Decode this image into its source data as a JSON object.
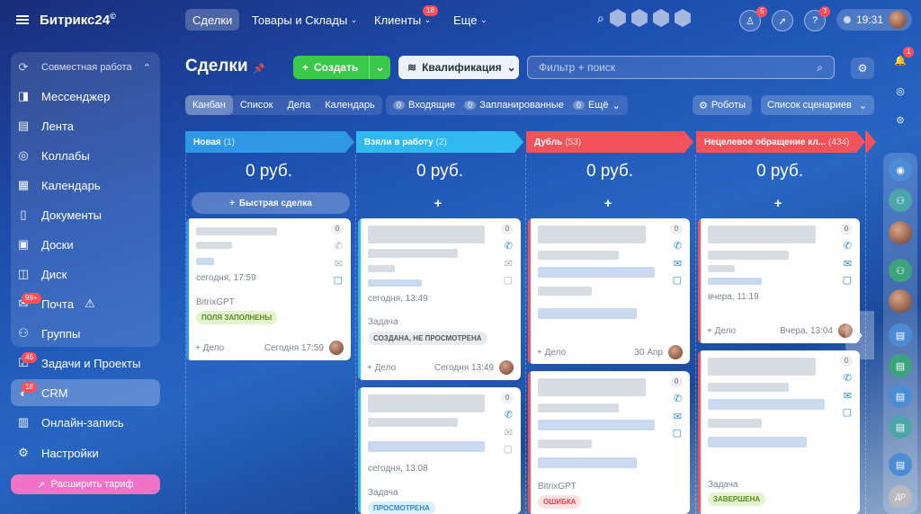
{
  "app": {
    "logo": "Битрикс24",
    "logo_mark": "©"
  },
  "sidebar": {
    "group_label": "Совместная работа",
    "items": [
      {
        "label": "Мессенджер",
        "icon": "chat-icon"
      },
      {
        "label": "Лента",
        "icon": "feed-icon"
      },
      {
        "label": "Коллабы",
        "icon": "collab-icon"
      },
      {
        "label": "Календарь",
        "icon": "calendar-icon"
      },
      {
        "label": "Документы",
        "icon": "document-icon"
      },
      {
        "label": "Доски",
        "icon": "board-icon"
      },
      {
        "label": "Диск",
        "icon": "disk-icon"
      },
      {
        "label": "Почта",
        "icon": "mail-icon",
        "badge": "99+"
      },
      {
        "label": "Группы",
        "icon": "groups-icon"
      },
      {
        "label": "Задачи и Проекты",
        "icon": "tasks-icon",
        "badge": "46"
      },
      {
        "label": "CRM",
        "icon": "crm-icon",
        "badge": "18"
      },
      {
        "label": "Онлайн-запись",
        "icon": "booking-icon"
      },
      {
        "label": "Настройки",
        "icon": "gear-icon"
      }
    ],
    "upgrade_label": "Расширить тариф"
  },
  "topnav": {
    "tabs": [
      {
        "label": "Сделки"
      },
      {
        "label": "Товары и Склады"
      },
      {
        "label": "Клиенты",
        "badge": "18"
      },
      {
        "label": "Еще"
      }
    ],
    "notif_badges": [
      "5",
      "7"
    ],
    "time": "19:31"
  },
  "toolbar": {
    "title": "Сделки",
    "create_label": "Создать",
    "qual_label": "Квалификация",
    "filter_placeholder": "Фильтр + поиск"
  },
  "views": [
    "Канбан",
    "Список",
    "Дела",
    "Календарь"
  ],
  "counters": [
    {
      "n": "0",
      "label": "Входящие"
    },
    {
      "n": "0",
      "label": "Запланированные"
    },
    {
      "n": "0",
      "label": "Ещё"
    }
  ],
  "robots_label": "Роботы",
  "scenarios_label": "Список сценариев",
  "quick_deal_label": "Быстрая сделка",
  "columns": [
    {
      "name": "Новая",
      "count": "(1)",
      "sum": "0 руб.",
      "color": "#2f98e6"
    },
    {
      "name": "Взяли в работу",
      "count": "(2)",
      "sum": "0 руб.",
      "color": "#2fb9ee"
    },
    {
      "name": "Дубль",
      "count": "(53)",
      "sum": "0 руб.",
      "color": "#f2525a"
    },
    {
      "name": "Нецелевое обращение кл...",
      "count": "(434)",
      "sum": "0 руб.",
      "color": "#f2525a"
    }
  ],
  "cards": {
    "c1": {
      "time": "сегодня, 17:59",
      "source": "BitrixGPT",
      "tag": "ПОЛЯ ЗАПОЛНЕНЫ",
      "deal": "+ Дело",
      "date": "Сегодня 17:59",
      "zero": "0"
    },
    "c2": {
      "time": "сегодня, 13:49",
      "source": "Задача",
      "tag": "СОЗДАНА, НЕ ПРОСМОТРЕНА",
      "deal": "+ Дело",
      "date": "Сегодня 13:49",
      "zero": "0"
    },
    "c3": {
      "time": "сегодня, 13:08",
      "source": "Задача",
      "tag": "ПРОСМОТРЕНА",
      "zero": "0"
    },
    "c4": {
      "deal": "+ Дело",
      "date": "30 Апр",
      "zero": "0"
    },
    "c5": {
      "source": "BitrixGPT",
      "tag": "ОШИБКА",
      "zero": "0"
    },
    "c6": {
      "time": "вчера, 11:19",
      "deal": "+ Дело",
      "date": "Вчера, 13:04",
      "zero": "0"
    },
    "c7": {
      "source": "Задача",
      "tag": "ЗАВЕРШЕНА",
      "zero": "0"
    }
  },
  "right_bar": {
    "badge": "1",
    "initials": "ДР"
  }
}
